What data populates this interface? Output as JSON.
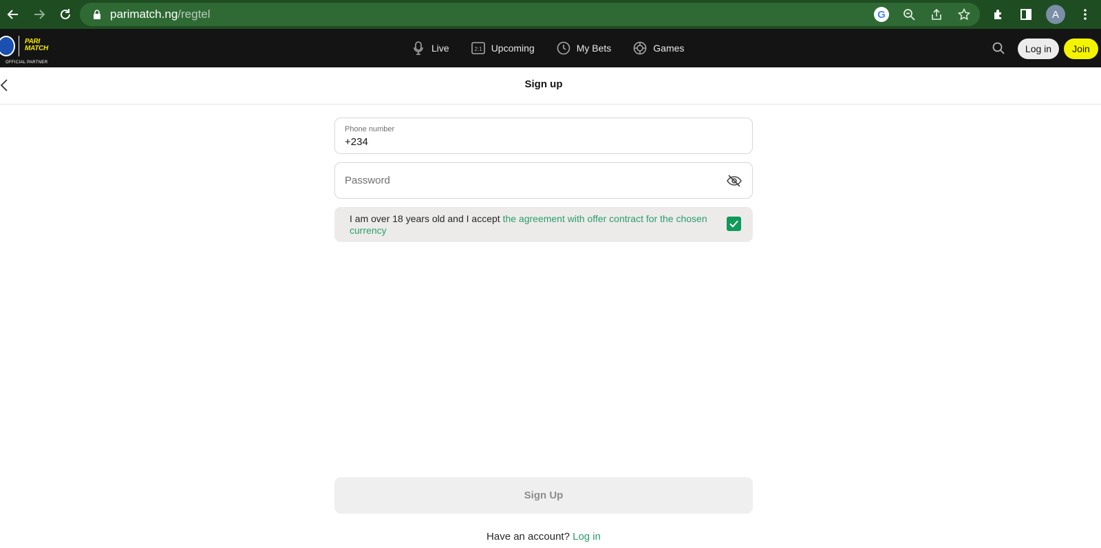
{
  "browser": {
    "url_domain": "parimatch.ng",
    "url_path": "/regtel",
    "profile_initial": "A",
    "icons": [
      "back-icon",
      "forward-icon",
      "reload-icon",
      "lock-icon",
      "google-icon",
      "zoom-icon",
      "share-icon",
      "star-icon",
      "extensions-icon",
      "side-panel-icon",
      "menu-icon"
    ]
  },
  "site": {
    "brand_top": "PARI",
    "brand_bottom": "MATCH",
    "partner_text": "OFFICIAL PARTNER",
    "nav": [
      {
        "label": "Live",
        "icon": "microphone-icon"
      },
      {
        "label": "Upcoming",
        "icon": "score-icon"
      },
      {
        "label": "My Bets",
        "icon": "clock-icon"
      },
      {
        "label": "Games",
        "icon": "games-icon"
      }
    ],
    "login_label": "Log in",
    "join_label": "Join",
    "colors": {
      "header_bg": "#141414",
      "join_bg": "#f4f400",
      "accent": "#2a9d68",
      "check": "#0f9a5a"
    }
  },
  "page": {
    "title": "Sign up"
  },
  "form": {
    "phone_label": "Phone number",
    "phone_value": "+234",
    "password_placeholder": "Password",
    "agree_prefix": "I am over 18 years old and I accept ",
    "agree_link": "the agreement with offer contract for the chosen currency",
    "agree_checked": true,
    "submit_label": "Sign Up",
    "have_account": "Have an account? ",
    "login_link": "Log in"
  }
}
